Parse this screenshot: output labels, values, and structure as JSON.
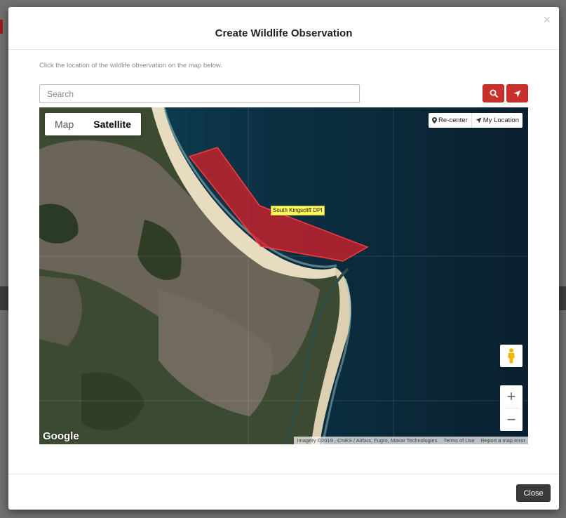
{
  "modal": {
    "title": "Create Wildlife Observation",
    "close_symbol": "×",
    "instructions": "Click the location of the wildlife observation on the map below."
  },
  "search": {
    "placeholder": "Search",
    "search_icon": "search-icon",
    "locate_icon": "location-arrow-icon"
  },
  "map": {
    "type_map_label": "Map",
    "type_satellite_label": "Satellite",
    "selected_type": "Satellite",
    "recenter_label": "Re-center",
    "my_location_label": "My Location",
    "polygon_label": "South Kingscliff DPI",
    "polygon_color": "#e0202a",
    "zoom_in": "+",
    "zoom_out": "−",
    "logo": "Google",
    "attribution": {
      "imagery": "Imagery ©2019 , CNES / Airbus, Fugro, Maxar Technologies",
      "terms": "Terms of Use",
      "report": "Report a map error"
    }
  },
  "footer": {
    "close_label": "Close"
  },
  "colors": {
    "accent_red": "#c9302c",
    "close_button": "#3a3a3a"
  }
}
